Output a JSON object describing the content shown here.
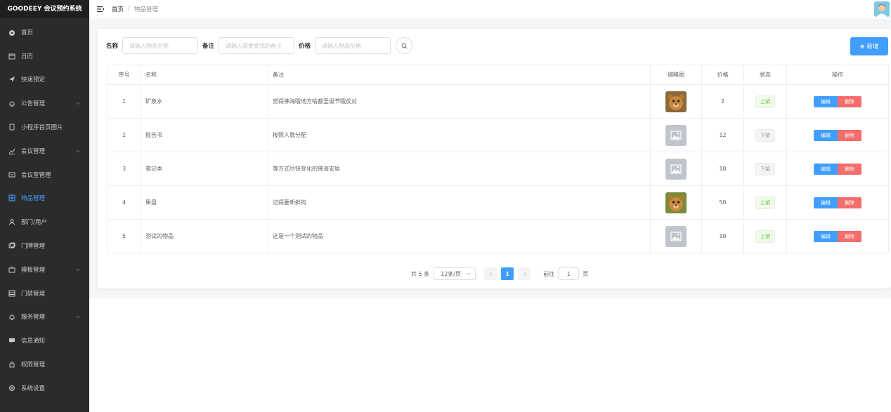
{
  "app": {
    "title": "GOODEEY 会议预约系统"
  },
  "sidebar": {
    "items": [
      {
        "label": "首页",
        "icon": "dashboard-icon",
        "chevron": false,
        "active": false
      },
      {
        "label": "日历",
        "icon": "calendar-icon",
        "chevron": false,
        "active": false
      },
      {
        "label": "快速预定",
        "icon": "send-icon",
        "chevron": false,
        "active": false
      },
      {
        "label": "公告管理",
        "icon": "bell-icon",
        "chevron": true,
        "active": false
      },
      {
        "label": "小程序首页图片",
        "icon": "mobile-icon",
        "chevron": false,
        "active": false
      },
      {
        "label": "会议管理",
        "icon": "chart-icon",
        "chevron": true,
        "active": false
      },
      {
        "label": "会议室管理",
        "icon": "room-icon",
        "chevron": false,
        "active": false
      },
      {
        "label": "物品管理",
        "icon": "grid-icon",
        "chevron": false,
        "active": true
      },
      {
        "label": "部门/用户",
        "icon": "user-icon",
        "chevron": false,
        "active": false
      },
      {
        "label": "门牌管理",
        "icon": "doorplate-icon",
        "chevron": false,
        "active": false
      },
      {
        "label": "模板管理",
        "icon": "template-icon",
        "chevron": true,
        "active": false
      },
      {
        "label": "门禁管理",
        "icon": "access-icon",
        "chevron": false,
        "active": false
      },
      {
        "label": "服务管理",
        "icon": "bell-icon",
        "chevron": true,
        "active": false
      },
      {
        "label": "信息通知",
        "icon": "message-icon",
        "chevron": false,
        "active": false
      },
      {
        "label": "权限管理",
        "icon": "lock-icon",
        "chevron": false,
        "active": false
      },
      {
        "label": "系统设置",
        "icon": "settings-icon",
        "chevron": false,
        "active": false
      }
    ]
  },
  "header": {
    "breadcrumb": {
      "home": "首页",
      "separator": "/",
      "current": "物品管理"
    }
  },
  "filter": {
    "name_label": "名称",
    "name_placeholder": "请输入物品名称",
    "remark_label": "备注",
    "remark_placeholder": "请输入需要查找的备注",
    "price_label": "价格",
    "price_placeholder": "请输入物品价格",
    "add_label": "⊕ 新增"
  },
  "table": {
    "columns": [
      "序号",
      "名称",
      "备注",
      "缩略图",
      "价格",
      "状态",
      "操作"
    ],
    "edit_label": "编辑",
    "delete_label": "删除",
    "rows": [
      {
        "index": "1",
        "name": "矿泉水",
        "remark": "觉得佛海哦地方啥都圣诞节哦反对",
        "thumb": "bear",
        "price": "2",
        "status": "上架",
        "on": true
      },
      {
        "index": "2",
        "name": "报告书",
        "remark": "按照人数分配",
        "thumb": "placeholder",
        "price": "12",
        "status": "下架",
        "on": false
      },
      {
        "index": "3",
        "name": "笔记本",
        "remark": "等方式尽快变化的佛海安居",
        "thumb": "placeholder",
        "price": "10",
        "status": "下架",
        "on": false
      },
      {
        "index": "4",
        "name": "果盘",
        "remark": "记得要新鲜的",
        "thumb": "bear2",
        "price": "50",
        "status": "上架",
        "on": true
      },
      {
        "index": "5",
        "name": "测试的物品",
        "remark": "这是一个测试的物品",
        "thumb": "placeholder",
        "price": "10",
        "status": "上架",
        "on": true
      }
    ]
  },
  "pagination": {
    "total": "共 5 条",
    "page_size": "12条/页",
    "current_page": "1",
    "goto_label": "前往",
    "goto_value": "1",
    "page_suffix": "页"
  },
  "colors": {
    "primary": "#409eff",
    "danger": "#f56c6c",
    "success": "#67c23a",
    "sidebar_bg": "#2b2b2b"
  }
}
